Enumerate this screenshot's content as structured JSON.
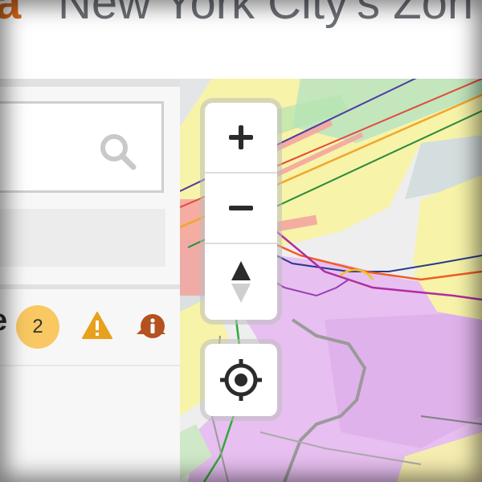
{
  "header": {
    "brand_fragment": "a",
    "title": "New York City's Zon"
  },
  "sidebar": {
    "search": {
      "value": "",
      "placeholder": ""
    },
    "layer": {
      "name_tail": "e",
      "count": "2"
    }
  },
  "map_controls": {
    "zoom_in": "+",
    "zoom_out": "−"
  },
  "colors": {
    "brand": "#d96a1c",
    "badge": "#f9c862",
    "collapse_arrow": "#b5511f",
    "warning": "#e8a11c",
    "info": "#b5511f",
    "zoning_commercial": "#f4a6a0",
    "zoning_residential": "#f7f3a9",
    "zoning_manufacturing": "#e7bff0",
    "park": "#b5e3b1",
    "water": "#cfd9d9"
  }
}
